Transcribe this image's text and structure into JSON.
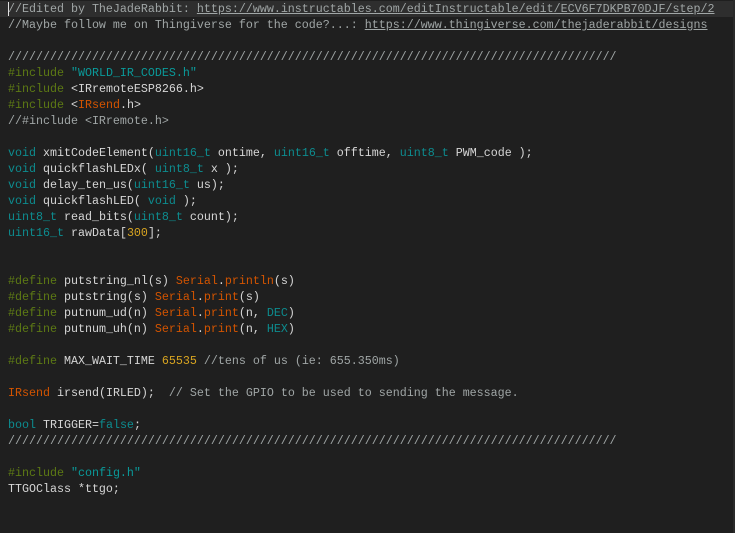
{
  "colors": {
    "background": "#1f1f1f",
    "current_line": "#2e2e2e",
    "preprocessor": "#5d7a14",
    "type": "#0d8c8f",
    "function": "#d35400",
    "number": "#d9a520",
    "comment": "#a0a6a6"
  },
  "lines": [
    [
      {
        "t": "//Edited by TheJadeRabbit: ",
        "c": "comment"
      },
      {
        "t": "https://www.instructables.com/editInstructable/edit/ECV6F7DKPB70DJF/step/2",
        "c": "link"
      }
    ],
    [
      {
        "t": "//Maybe follow me on Thingiverse for the code?...: ",
        "c": "comment"
      },
      {
        "t": "https://www.thingiverse.com/thejaderabbit/designs",
        "c": "link"
      }
    ],
    [],
    [
      {
        "t": "///////////////////////////////////////////////////////////////////////////////////////",
        "c": "comment"
      }
    ],
    [
      {
        "t": "#include ",
        "c": "pre"
      },
      {
        "t": "\"WORLD_IR_CODES.h\"",
        "c": "str"
      }
    ],
    [
      {
        "t": "#include ",
        "c": "pre"
      },
      {
        "t": "<IRremoteESP8266.h>",
        "c": "plain"
      }
    ],
    [
      {
        "t": "#include ",
        "c": "pre"
      },
      {
        "t": "<",
        "c": "plain"
      },
      {
        "t": "IRsend",
        "c": "fn"
      },
      {
        "t": ".h>",
        "c": "plain"
      }
    ],
    [
      {
        "t": "//#include <IRremote.h>",
        "c": "comment"
      }
    ],
    [],
    [
      {
        "t": "void",
        "c": "type"
      },
      {
        "t": " xmitCodeElement(",
        "c": "plain"
      },
      {
        "t": "uint16_t",
        "c": "type"
      },
      {
        "t": " ontime, ",
        "c": "plain"
      },
      {
        "t": "uint16_t",
        "c": "type"
      },
      {
        "t": " offtime, ",
        "c": "plain"
      },
      {
        "t": "uint8_t",
        "c": "type"
      },
      {
        "t": " PWM_code );",
        "c": "plain"
      }
    ],
    [
      {
        "t": "void",
        "c": "type"
      },
      {
        "t": " quickflashLEDx( ",
        "c": "plain"
      },
      {
        "t": "uint8_t",
        "c": "type"
      },
      {
        "t": " x );",
        "c": "plain"
      }
    ],
    [
      {
        "t": "void",
        "c": "type"
      },
      {
        "t": " delay_ten_us(",
        "c": "plain"
      },
      {
        "t": "uint16_t",
        "c": "type"
      },
      {
        "t": " us);",
        "c": "plain"
      }
    ],
    [
      {
        "t": "void",
        "c": "type"
      },
      {
        "t": " quickflashLED( ",
        "c": "plain"
      },
      {
        "t": "void",
        "c": "type"
      },
      {
        "t": " );",
        "c": "plain"
      }
    ],
    [
      {
        "t": "uint8_t",
        "c": "type"
      },
      {
        "t": " read_bits(",
        "c": "plain"
      },
      {
        "t": "uint8_t",
        "c": "type"
      },
      {
        "t": " count);",
        "c": "plain"
      }
    ],
    [
      {
        "t": "uint16_t",
        "c": "type"
      },
      {
        "t": " rawData[",
        "c": "plain"
      },
      {
        "t": "300",
        "c": "num"
      },
      {
        "t": "];",
        "c": "plain"
      }
    ],
    [],
    [],
    [
      {
        "t": "#define ",
        "c": "pre"
      },
      {
        "t": "putstring_nl(s) ",
        "c": "plain"
      },
      {
        "t": "Serial",
        "c": "fn"
      },
      {
        "t": ".",
        "c": "plain"
      },
      {
        "t": "println",
        "c": "fn"
      },
      {
        "t": "(s)",
        "c": "plain"
      }
    ],
    [
      {
        "t": "#define ",
        "c": "pre"
      },
      {
        "t": "putstring(s) ",
        "c": "plain"
      },
      {
        "t": "Serial",
        "c": "fn"
      },
      {
        "t": ".",
        "c": "plain"
      },
      {
        "t": "print",
        "c": "fn"
      },
      {
        "t": "(s)",
        "c": "plain"
      }
    ],
    [
      {
        "t": "#define ",
        "c": "pre"
      },
      {
        "t": "putnum_ud(n) ",
        "c": "plain"
      },
      {
        "t": "Serial",
        "c": "fn"
      },
      {
        "t": ".",
        "c": "plain"
      },
      {
        "t": "print",
        "c": "fn"
      },
      {
        "t": "(n, ",
        "c": "plain"
      },
      {
        "t": "DEC",
        "c": "const"
      },
      {
        "t": ")",
        "c": "plain"
      }
    ],
    [
      {
        "t": "#define ",
        "c": "pre"
      },
      {
        "t": "putnum_uh(n) ",
        "c": "plain"
      },
      {
        "t": "Serial",
        "c": "fn"
      },
      {
        "t": ".",
        "c": "plain"
      },
      {
        "t": "print",
        "c": "fn"
      },
      {
        "t": "(n, ",
        "c": "plain"
      },
      {
        "t": "HEX",
        "c": "const"
      },
      {
        "t": ")",
        "c": "plain"
      }
    ],
    [],
    [
      {
        "t": "#define ",
        "c": "pre"
      },
      {
        "t": "MAX_WAIT_TIME ",
        "c": "plain"
      },
      {
        "t": "65535",
        "c": "num"
      },
      {
        "t": " //tens of us (ie: 655.350ms)",
        "c": "comment"
      }
    ],
    [],
    [
      {
        "t": "IRsend",
        "c": "fn"
      },
      {
        "t": " irsend(IRLED);  ",
        "c": "plain"
      },
      {
        "t": "// Set the GPIO to be used to sending the message.",
        "c": "comment"
      }
    ],
    [],
    [
      {
        "t": "bool",
        "c": "type"
      },
      {
        "t": " TRIGGER=",
        "c": "plain"
      },
      {
        "t": "false",
        "c": "type"
      },
      {
        "t": ";",
        "c": "plain"
      }
    ],
    [
      {
        "t": "///////////////////////////////////////////////////////////////////////////////////////",
        "c": "comment"
      }
    ],
    [],
    [
      {
        "t": "#include ",
        "c": "pre"
      },
      {
        "t": "\"config.h\"",
        "c": "str"
      }
    ],
    [
      {
        "t": "TTGOClass *ttgo;",
        "c": "plain"
      }
    ]
  ]
}
